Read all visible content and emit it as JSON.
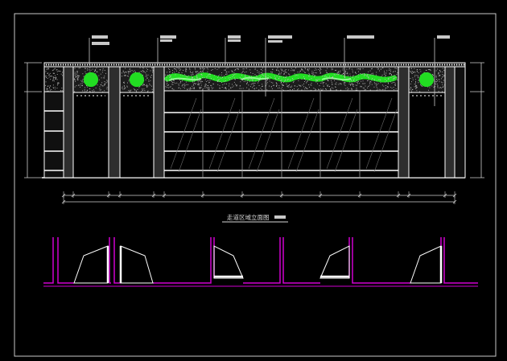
{
  "drawing": {
    "title": "走道区域立面图",
    "colors": {
      "background": "#000000",
      "frame": "#c8c8c8",
      "line": "#ffffff",
      "grey_line": "#9a9a9a",
      "wall_fill": "#2e2e2e",
      "stone_fill": "#1c1c1c",
      "plant": "#22dd22",
      "plan_wall": "#d000d0",
      "label_block": "#c8c8c8",
      "dim": "#d0d0d0"
    }
  }
}
